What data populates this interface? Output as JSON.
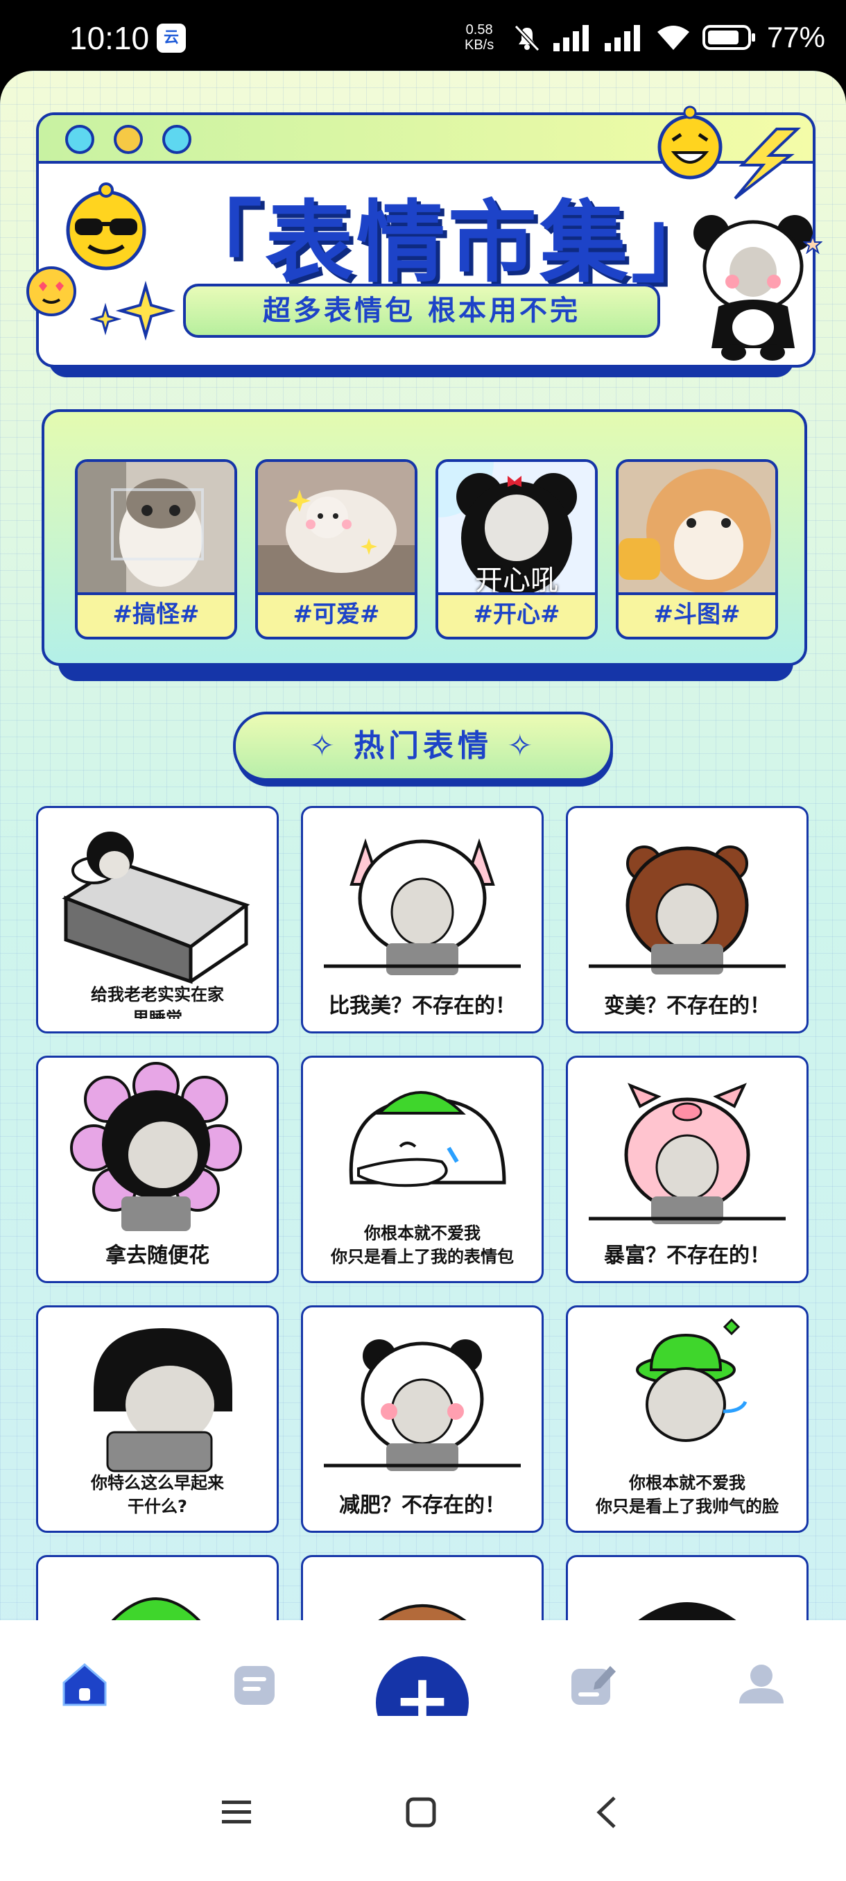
{
  "status_bar": {
    "time": "10:10",
    "app_badge": "云",
    "net_speed_value": "0.58",
    "net_speed_unit": "KB/s",
    "battery": "77%"
  },
  "banner": {
    "title": "「表情市集」",
    "subtitle": "超多表情包 根本用不完",
    "dot_colors": [
      "#5ed7f0",
      "#f6c945",
      "#5ed7f0"
    ]
  },
  "categories": [
    {
      "label": "#搞怪#",
      "overlay": ""
    },
    {
      "label": "#可爱#",
      "overlay": ""
    },
    {
      "label": "#开心#",
      "overlay": "开心吼"
    },
    {
      "label": "#斗图#",
      "overlay": ""
    }
  ],
  "section": {
    "title": "✧ 热门表情 ✧"
  },
  "stickers": [
    {
      "caption": "给我老老实实在家",
      "caption2": "里睡觉",
      "icon": "bed-meme-icon"
    },
    {
      "caption": "比我美？不存在的！",
      "caption2": "",
      "icon": "cat-hood-meme-icon"
    },
    {
      "caption": "变美？不存在的！",
      "caption2": "",
      "icon": "bear-hood-meme-icon"
    },
    {
      "caption": "拿去随便花",
      "caption2": "",
      "icon": "flower-meme-icon"
    },
    {
      "caption": "你根本就不爱我",
      "caption2": "你只是看上了我的表情包",
      "icon": "green-hat-duck-icon"
    },
    {
      "caption": "暴富？不存在的！",
      "caption2": "",
      "icon": "pig-hood-meme-icon"
    },
    {
      "caption": "你特么这么早起来",
      "caption2": "干什么?",
      "icon": "bowlcut-meme-icon"
    },
    {
      "caption": "减肥？不存在的！",
      "caption2": "",
      "icon": "panda-hood-meme-icon"
    },
    {
      "caption": "你根本就不爱我",
      "caption2": "你只是看上了我帅气的脸",
      "icon": "green-hat-meme-icon"
    }
  ],
  "bottom_nav": {
    "items": [
      {
        "label": "市集",
        "active": true
      },
      {
        "label": "模板",
        "active": false
      },
      {
        "label": "制作",
        "active": false
      },
      {
        "label": "我的",
        "active": false
      }
    ],
    "fab_label": "+",
    "active_color": "#1d43c8",
    "inactive_color": "#b3b8c4"
  }
}
